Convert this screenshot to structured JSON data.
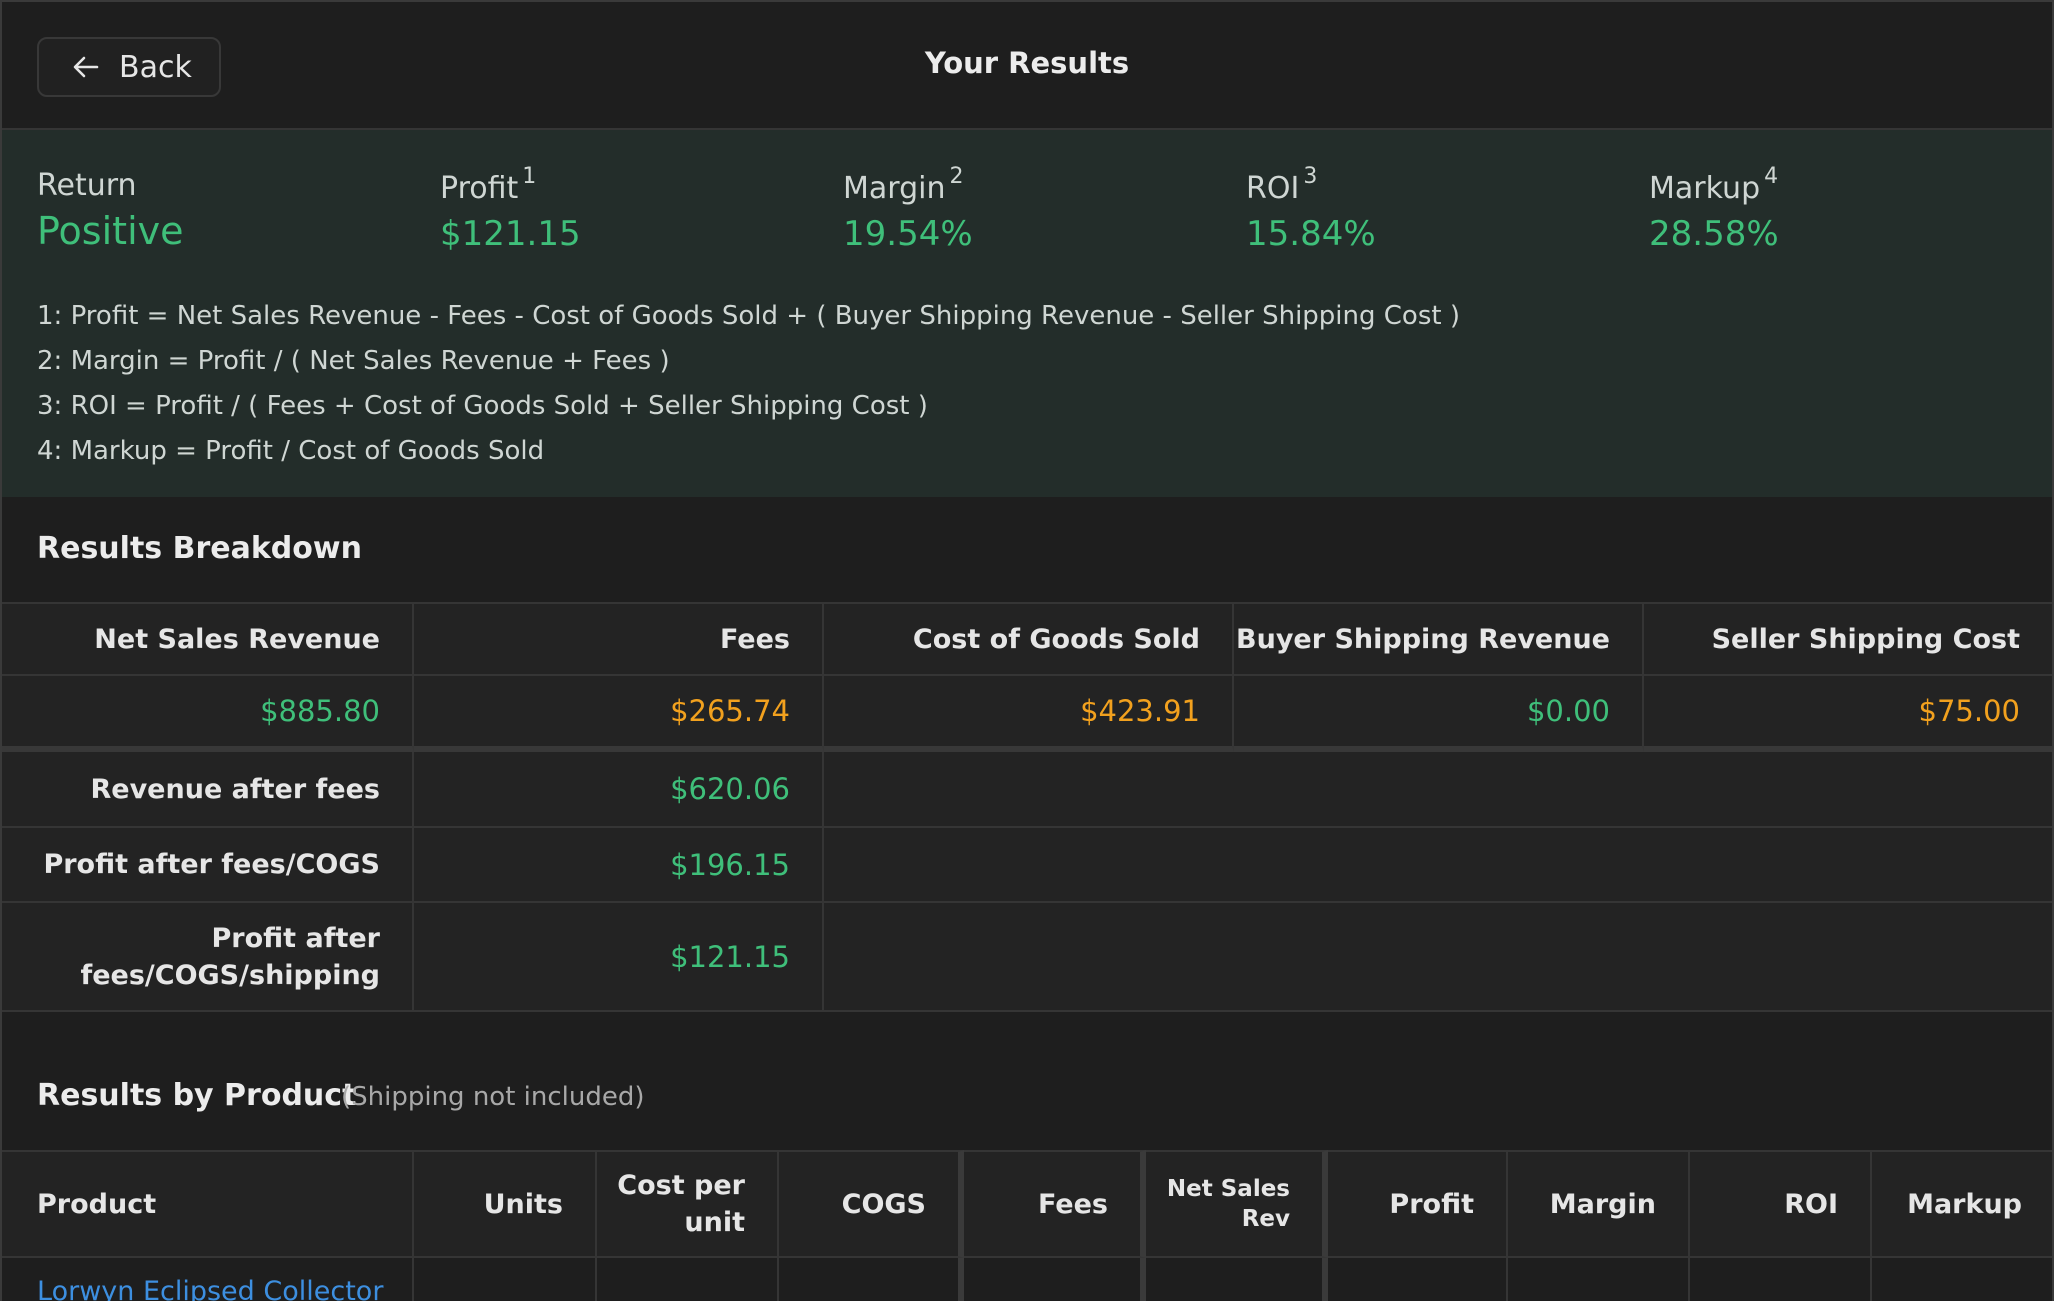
{
  "header": {
    "back_label": "Back",
    "title": "Your Results"
  },
  "summary": {
    "return_label": "Return",
    "return_value": "Positive",
    "metrics": [
      {
        "label": "Profit",
        "sup": "1",
        "value": "$121.15"
      },
      {
        "label": "Margin",
        "sup": "2",
        "value": "19.54%"
      },
      {
        "label": "ROI",
        "sup": "3",
        "value": "15.84%"
      },
      {
        "label": "Markup",
        "sup": "4",
        "value": "28.58%"
      }
    ],
    "notes": [
      "1: Profit = Net Sales Revenue - Fees - Cost of Goods Sold + ( Buyer Shipping Revenue - Seller Shipping Cost )",
      "2: Margin = Profit / ( Net Sales Revenue + Fees )",
      "3: ROI = Profit / ( Fees + Cost of Goods Sold + Seller Shipping Cost )",
      "4: Markup = Profit / Cost of Goods Sold"
    ]
  },
  "breakdown": {
    "title": "Results Breakdown",
    "headers": [
      "Net Sales Revenue",
      "Fees",
      "Cost of Goods Sold",
      "Buyer Shipping Revenue",
      "Seller Shipping Cost"
    ],
    "values": [
      "$885.80",
      "$265.74",
      "$423.91",
      "$0.00",
      "$75.00"
    ],
    "rows": [
      {
        "label": "Revenue after fees",
        "value": "$620.06"
      },
      {
        "label": "Profit after fees/COGS",
        "value": "$196.15"
      },
      {
        "label_line1": "Profit after",
        "label_line2": "fees/COGS/shipping",
        "value": "$121.15"
      }
    ]
  },
  "by_product": {
    "title": "Results by Product",
    "subtitle": "(Shipping not included)",
    "headers": {
      "product": "Product",
      "units": "Units",
      "cost_per_unit_1": "Cost per",
      "cost_per_unit_2": "unit",
      "cogs": "COGS",
      "fees": "Fees",
      "net_sales_1": "Net Sales",
      "net_sales_2": "Rev",
      "profit": "Profit",
      "margin": "Margin",
      "roi": "ROI",
      "markup": "Markup"
    },
    "first_product": "Lorwyn Eclipsed Collector"
  },
  "colors": {
    "positive": "#3fbf7a",
    "negative": "#f2a11e",
    "link": "#3d8fe0",
    "summary_bg": "#232d2a"
  }
}
